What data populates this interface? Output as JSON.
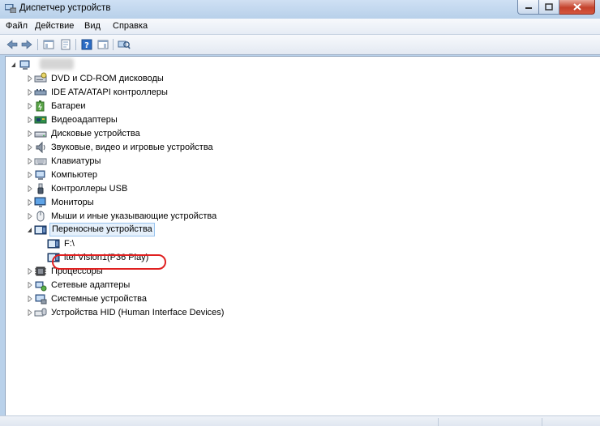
{
  "window": {
    "title": "Диспетчер устройств"
  },
  "menu": [
    "Файл",
    "Действие",
    "Вид",
    "Справка"
  ],
  "toolbar": {
    "buttons": [
      "back-arrow-icon",
      "forward-arrow-icon",
      "show-hide-tree-icon",
      "properties-icon",
      "help-icon",
      "console-view-icon",
      "scan-hardware-icon"
    ]
  },
  "tree": {
    "root_label": "",
    "categories": [
      {
        "label": "DVD и CD-ROM дисководы",
        "icon": "dvd-drive-icon"
      },
      {
        "label": "IDE ATA/ATAPI контроллеры",
        "icon": "ide-controller-icon"
      },
      {
        "label": "Батареи",
        "icon": "battery-icon"
      },
      {
        "label": "Видеоадаптеры",
        "icon": "display-adapter-icon"
      },
      {
        "label": "Дисковые устройства",
        "icon": "disk-drive-icon"
      },
      {
        "label": "Звуковые, видео и игровые устройства",
        "icon": "sound-icon"
      },
      {
        "label": "Клавиатуры",
        "icon": "keyboard-icon"
      },
      {
        "label": "Компьютер",
        "icon": "computer-icon"
      },
      {
        "label": "Контроллеры USB",
        "icon": "usb-icon"
      },
      {
        "label": "Мониторы",
        "icon": "monitor-icon"
      },
      {
        "label": "Мыши и иные указывающие устройства",
        "icon": "mouse-icon"
      },
      {
        "label": "Переносные устройства",
        "icon": "portable-device-icon",
        "expanded": true,
        "children": [
          {
            "label": "F:\\",
            "icon": "portable-device-icon"
          },
          {
            "label": "itel Vision1(P36 Play)",
            "icon": "portable-device-icon",
            "highlighted": true
          }
        ]
      },
      {
        "label": "Процессоры",
        "icon": "processor-icon"
      },
      {
        "label": "Сетевые адаптеры",
        "icon": "network-adapter-icon"
      },
      {
        "label": "Системные устройства",
        "icon": "system-devices-icon"
      },
      {
        "label": "Устройства HID (Human Interface Devices)",
        "icon": "hid-icon"
      }
    ]
  },
  "colors": {
    "highlight_oval": "#e02020",
    "selection_bg": "#e5f0fb",
    "selection_border": "#99c4ee"
  }
}
